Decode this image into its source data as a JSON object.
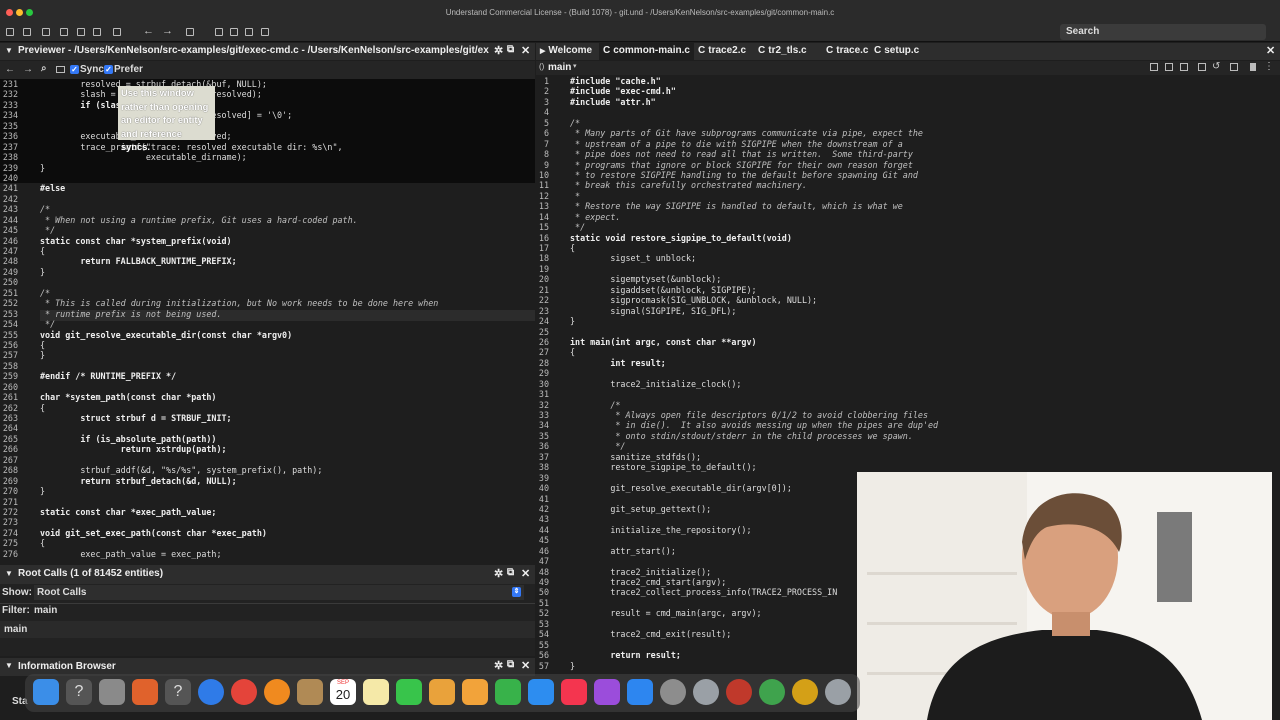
{
  "window": {
    "title": "Understand Commercial License - (Build 1078) - git.und - /Users/KenNelson/src-examples/git/common-main.c"
  },
  "toolbar": {
    "search_placeholder": "Search"
  },
  "previewer": {
    "title": "Previewer - /Users/KenNelson/src-examples/git/exec-cmd.c - /Users/KenNelson/src-examples/git/ex",
    "sync_label": "Sync",
    "prefer_label": "Prefer",
    "tooltip": [
      "Use this window",
      "rather than opening",
      "an editor for entity",
      "and reference syncs."
    ],
    "lines": [
      {
        "n": "231",
        "t": "        resolved = strbuf_detach(&buf, NULL);"
      },
      {
        "n": "232",
        "t": "        slash = find_last_dir_sep(resolved);"
      },
      {
        "n": "233",
        "t": "        if (slash)"
      },
      {
        "n": "234",
        "t": "                resolved[slash - resolved] = '\\0';"
      },
      {
        "n": "235",
        "t": ""
      },
      {
        "n": "236",
        "t": "        executable_dirname = resolved;"
      },
      {
        "n": "237",
        "t": "        trace_printf(\"trace: resolved executable dir: %s\\n\","
      },
      {
        "n": "238",
        "t": "                     executable_dirname);"
      },
      {
        "n": "239",
        "t": "}"
      },
      {
        "n": "240",
        "t": ""
      },
      {
        "n": "241",
        "t": "#else"
      },
      {
        "n": "242",
        "t": ""
      },
      {
        "n": "243",
        "t": "/*"
      },
      {
        "n": "244",
        "t": " * When not using a runtime prefix, Git uses a hard-coded path."
      },
      {
        "n": "245",
        "t": " */"
      },
      {
        "n": "246",
        "t": "static const char *system_prefix(void)"
      },
      {
        "n": "247",
        "t": "{"
      },
      {
        "n": "248",
        "t": "        return FALLBACK_RUNTIME_PREFIX;"
      },
      {
        "n": "249",
        "t": "}"
      },
      {
        "n": "250",
        "t": ""
      },
      {
        "n": "251",
        "t": "/*"
      },
      {
        "n": "252",
        "t": " * This is called during initialization, but No work needs to be done here when"
      },
      {
        "n": "253",
        "t": " * runtime prefix is not being used."
      },
      {
        "n": "254",
        "t": " */"
      },
      {
        "n": "255",
        "t": "void git_resolve_executable_dir(const char *argv0)"
      },
      {
        "n": "256",
        "t": "{"
      },
      {
        "n": "257",
        "t": "}"
      },
      {
        "n": "258",
        "t": ""
      },
      {
        "n": "259",
        "t": "#endif /* RUNTIME_PREFIX */"
      },
      {
        "n": "260",
        "t": ""
      },
      {
        "n": "261",
        "t": "char *system_path(const char *path)"
      },
      {
        "n": "262",
        "t": "{"
      },
      {
        "n": "263",
        "t": "        struct strbuf d = STRBUF_INIT;"
      },
      {
        "n": "264",
        "t": ""
      },
      {
        "n": "265",
        "t": "        if (is_absolute_path(path))"
      },
      {
        "n": "266",
        "t": "                return xstrdup(path);"
      },
      {
        "n": "267",
        "t": ""
      },
      {
        "n": "268",
        "t": "        strbuf_addf(&d, \"%s/%s\", system_prefix(), path);"
      },
      {
        "n": "269",
        "t": "        return strbuf_detach(&d, NULL);"
      },
      {
        "n": "270",
        "t": "}"
      },
      {
        "n": "271",
        "t": ""
      },
      {
        "n": "272",
        "t": "static const char *exec_path_value;"
      },
      {
        "n": "273",
        "t": ""
      },
      {
        "n": "274",
        "t": "void git_set_exec_path(const char *exec_path)"
      },
      {
        "n": "275",
        "t": "{"
      },
      {
        "n": "276",
        "t": "        exec_path_value = exec_path;"
      }
    ]
  },
  "root_calls": {
    "title": "Root Calls (1 of 81452 entities)",
    "show_label": "Show:",
    "show_value": "Root Calls",
    "filter_label": "Filter:",
    "filter_value": "main",
    "items": [
      "main"
    ]
  },
  "info_browser": {
    "title": "Information Browser",
    "partial": "Sta"
  },
  "editor": {
    "tabs": [
      "Welcome",
      "common-main.c",
      "trace2.c",
      "tr2_tls.c",
      "trace.c",
      "setup.c"
    ],
    "scope": "main",
    "lines": [
      {
        "n": "1",
        "t": "#include \"cache.h\""
      },
      {
        "n": "2",
        "t": "#include \"exec-cmd.h\""
      },
      {
        "n": "3",
        "t": "#include \"attr.h\""
      },
      {
        "n": "4",
        "t": ""
      },
      {
        "n": "5",
        "t": "/*"
      },
      {
        "n": "6",
        "t": " * Many parts of Git have subprograms communicate via pipe, expect the"
      },
      {
        "n": "7",
        "t": " * upstream of a pipe to die with SIGPIPE when the downstream of a"
      },
      {
        "n": "8",
        "t": " * pipe does not need to read all that is written.  Some third-party"
      },
      {
        "n": "9",
        "t": " * programs that ignore or block SIGPIPE for their own reason forget"
      },
      {
        "n": "10",
        "t": " * to restore SIGPIPE handling to the default before spawning Git and"
      },
      {
        "n": "11",
        "t": " * break this carefully orchestrated machinery."
      },
      {
        "n": "12",
        "t": " *"
      },
      {
        "n": "13",
        "t": " * Restore the way SIGPIPE is handled to default, which is what we"
      },
      {
        "n": "14",
        "t": " * expect."
      },
      {
        "n": "15",
        "t": " */"
      },
      {
        "n": "16",
        "t": "static void restore_sigpipe_to_default(void)"
      },
      {
        "n": "17",
        "t": "{"
      },
      {
        "n": "18",
        "t": "        sigset_t unblock;"
      },
      {
        "n": "19",
        "t": ""
      },
      {
        "n": "20",
        "t": "        sigemptyset(&unblock);"
      },
      {
        "n": "21",
        "t": "        sigaddset(&unblock, SIGPIPE);"
      },
      {
        "n": "22",
        "t": "        sigprocmask(SIG_UNBLOCK, &unblock, NULL);"
      },
      {
        "n": "23",
        "t": "        signal(SIGPIPE, SIG_DFL);"
      },
      {
        "n": "24",
        "t": "}"
      },
      {
        "n": "25",
        "t": ""
      },
      {
        "n": "26",
        "t": "int main(int argc, const char **argv)"
      },
      {
        "n": "27",
        "t": "{"
      },
      {
        "n": "28",
        "t": "        int result;"
      },
      {
        "n": "29",
        "t": ""
      },
      {
        "n": "30",
        "t": "        trace2_initialize_clock();"
      },
      {
        "n": "31",
        "t": ""
      },
      {
        "n": "32",
        "t": "        /*"
      },
      {
        "n": "33",
        "t": "         * Always open file descriptors 0/1/2 to avoid clobbering files"
      },
      {
        "n": "34",
        "t": "         * in die().  It also avoids messing up when the pipes are dup'ed"
      },
      {
        "n": "35",
        "t": "         * onto stdin/stdout/stderr in the child processes we spawn."
      },
      {
        "n": "36",
        "t": "         */"
      },
      {
        "n": "37",
        "t": "        sanitize_stdfds();"
      },
      {
        "n": "38",
        "t": "        restore_sigpipe_to_default();"
      },
      {
        "n": "39",
        "t": ""
      },
      {
        "n": "40",
        "t": "        git_resolve_executable_dir(argv[0]);"
      },
      {
        "n": "41",
        "t": ""
      },
      {
        "n": "42",
        "t": "        git_setup_gettext();"
      },
      {
        "n": "43",
        "t": ""
      },
      {
        "n": "44",
        "t": "        initialize_the_repository();"
      },
      {
        "n": "45",
        "t": ""
      },
      {
        "n": "46",
        "t": "        attr_start();"
      },
      {
        "n": "47",
        "t": ""
      },
      {
        "n": "48",
        "t": "        trace2_initialize();"
      },
      {
        "n": "49",
        "t": "        trace2_cmd_start(argv);"
      },
      {
        "n": "50",
        "t": "        trace2_collect_process_info(TRACE2_PROCESS_IN"
      },
      {
        "n": "51",
        "t": ""
      },
      {
        "n": "52",
        "t": "        result = cmd_main(argc, argv);"
      },
      {
        "n": "53",
        "t": ""
      },
      {
        "n": "54",
        "t": "        trace2_cmd_exit(result);"
      },
      {
        "n": "55",
        "t": ""
      },
      {
        "n": "56",
        "t": "        return result;"
      },
      {
        "n": "57",
        "t": "}"
      }
    ]
  },
  "dock": {
    "calendar_month": "SEP",
    "calendar_day": "20",
    "icons": [
      "finder-icon",
      "help-icon",
      "app-icon",
      "launchpad-icon",
      "help-icon",
      "safari-icon",
      "chrome-icon",
      "firefox-icon",
      "app-icon",
      "calendar-icon",
      "notes-icon",
      "messages-icon",
      "photos-icon",
      "pages-icon",
      "numbers-icon",
      "keynote-icon",
      "music-icon",
      "podcasts-icon",
      "app-store-icon",
      "settings-icon",
      "understand-icon",
      "understand-icon",
      "understand-icon",
      "understand-icon",
      "understand-icon"
    ]
  }
}
